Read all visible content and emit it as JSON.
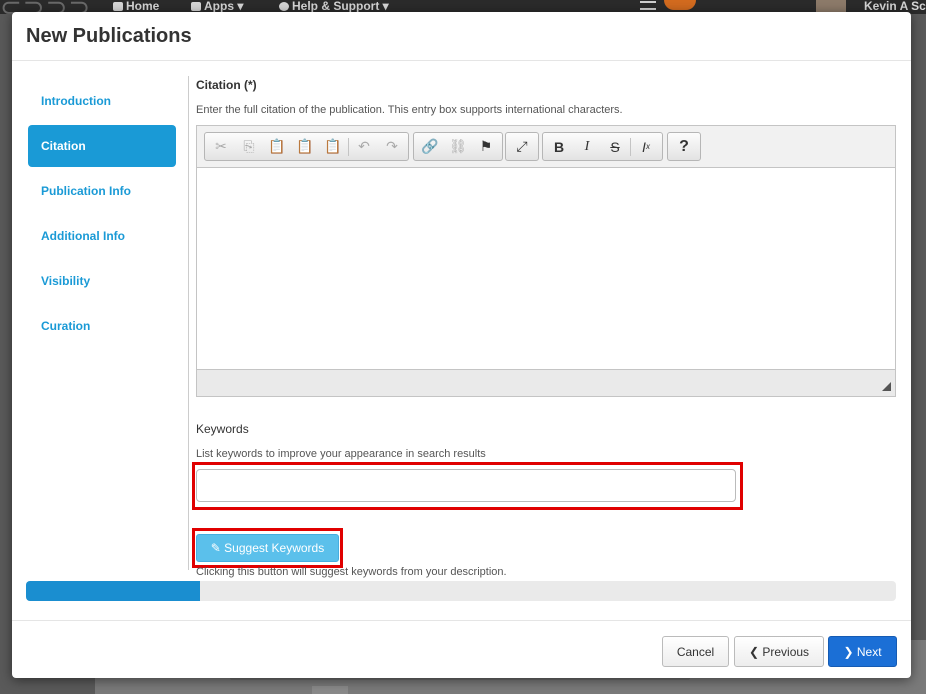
{
  "background": {
    "nav": {
      "home": "Home",
      "apps": "Apps",
      "help": "Help & Support"
    },
    "user_name": "Kevin A Sc"
  },
  "modal": {
    "title": "New Publications",
    "sidebar": {
      "items": [
        {
          "label": "Introduction",
          "active": false
        },
        {
          "label": "Citation",
          "active": true
        },
        {
          "label": "Publication Info",
          "active": false
        },
        {
          "label": "Additional Info",
          "active": false
        },
        {
          "label": "Visibility",
          "active": false
        },
        {
          "label": "Curation",
          "active": false
        }
      ]
    },
    "citation": {
      "label": "Citation (*)",
      "help": "Enter the full citation of the publication. This entry box supports international characters.",
      "editor_content": "",
      "toolbar_icons": [
        "cut-icon",
        "copy-icon",
        "paste-icon",
        "paste-text-icon",
        "paste-word-icon",
        "undo-icon",
        "redo-icon",
        "link-icon",
        "unlink-icon",
        "anchor-icon",
        "maximize-icon",
        "bold-icon",
        "italic-icon",
        "strikethrough-icon",
        "remove-format-icon",
        "help-icon"
      ]
    },
    "keywords": {
      "label": "Keywords",
      "help": "List keywords to improve your appearance in search results",
      "value": "",
      "suggest_button": "Suggest Keywords",
      "suggest_help": "Clicking this button will suggest keywords from your description."
    },
    "progress": 0.2,
    "footer": {
      "cancel": "Cancel",
      "previous": "Previous",
      "next": "Next"
    }
  },
  "colors": {
    "accent": "#1a9ad6",
    "primary_button": "#1b6fd6",
    "highlight": "#e00000",
    "suggest_button": "#5bc0eb"
  }
}
